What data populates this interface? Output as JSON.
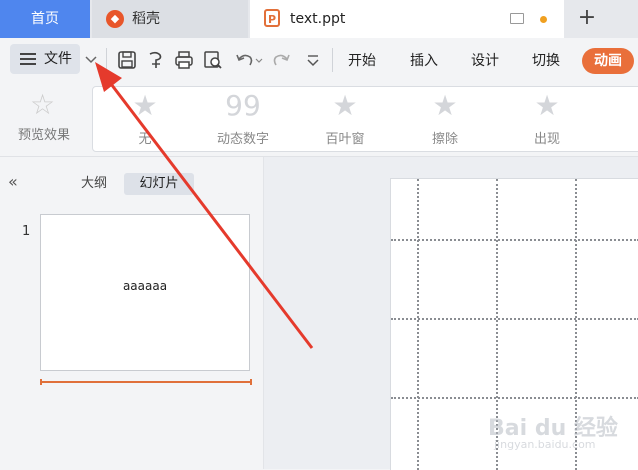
{
  "tabs": {
    "home": "首页",
    "daoke": "稻壳",
    "doc": "text.ppt",
    "add": "+"
  },
  "menu": {
    "file": "文件",
    "items": [
      "开始",
      "插入",
      "设计",
      "切换"
    ],
    "active": "动画"
  },
  "ribbon": {
    "preview": "预览效果",
    "effects": [
      "无",
      "动态数字",
      "百叶窗",
      "擦除",
      "出现"
    ]
  },
  "left_panel": {
    "tab_outline": "大纲",
    "tab_slides": "幻灯片",
    "slide_number": "1",
    "slide_text": "aaaaaa"
  },
  "watermark": {
    "line1": "Bai du 经验",
    "line2": "jingyan.baidu.com"
  },
  "colors": {
    "home_tab": "#4f86ee",
    "accent": "#e96f3a",
    "arrow": "#e53a2c"
  },
  "icons": [
    "hamburger-icon",
    "chevron-down-icon",
    "save-icon",
    "format-painter-icon",
    "print-icon",
    "print-preview-icon",
    "undo-icon",
    "redo-icon",
    "more-icon",
    "star-icon",
    "collapse-icon"
  ]
}
